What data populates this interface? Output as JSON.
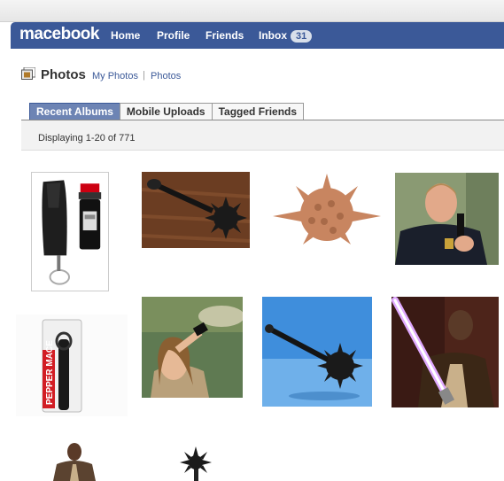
{
  "topnav": {
    "brand": "macebook",
    "items": [
      "Home",
      "Profile",
      "Friends",
      "Inbox"
    ],
    "inbox_count": "31"
  },
  "page": {
    "title": "Photos",
    "breadcrumbs": [
      "My Photos",
      "Photos"
    ]
  },
  "tabs": [
    "Recent Albums",
    "Mobile Uploads",
    "Tagged Friends"
  ],
  "active_tab": "Recent Albums",
  "info": "Displaying 1-20 of 771",
  "photos": [
    "pepper-spray-holster",
    "spiked-mace-on-wood",
    "ceramic-spiked-ball",
    "officer-with-pepper-spray",
    "pepper-mace-package",
    "woman-spraying-pepper-spray",
    "mace-on-blue-background",
    "jedi-with-purple-lightsaber",
    "jedi-figure",
    "spiked-mace-head"
  ],
  "colors": {
    "brand": "#3b5998",
    "tab_active": "#6d84b4",
    "link": "#3b5998"
  }
}
